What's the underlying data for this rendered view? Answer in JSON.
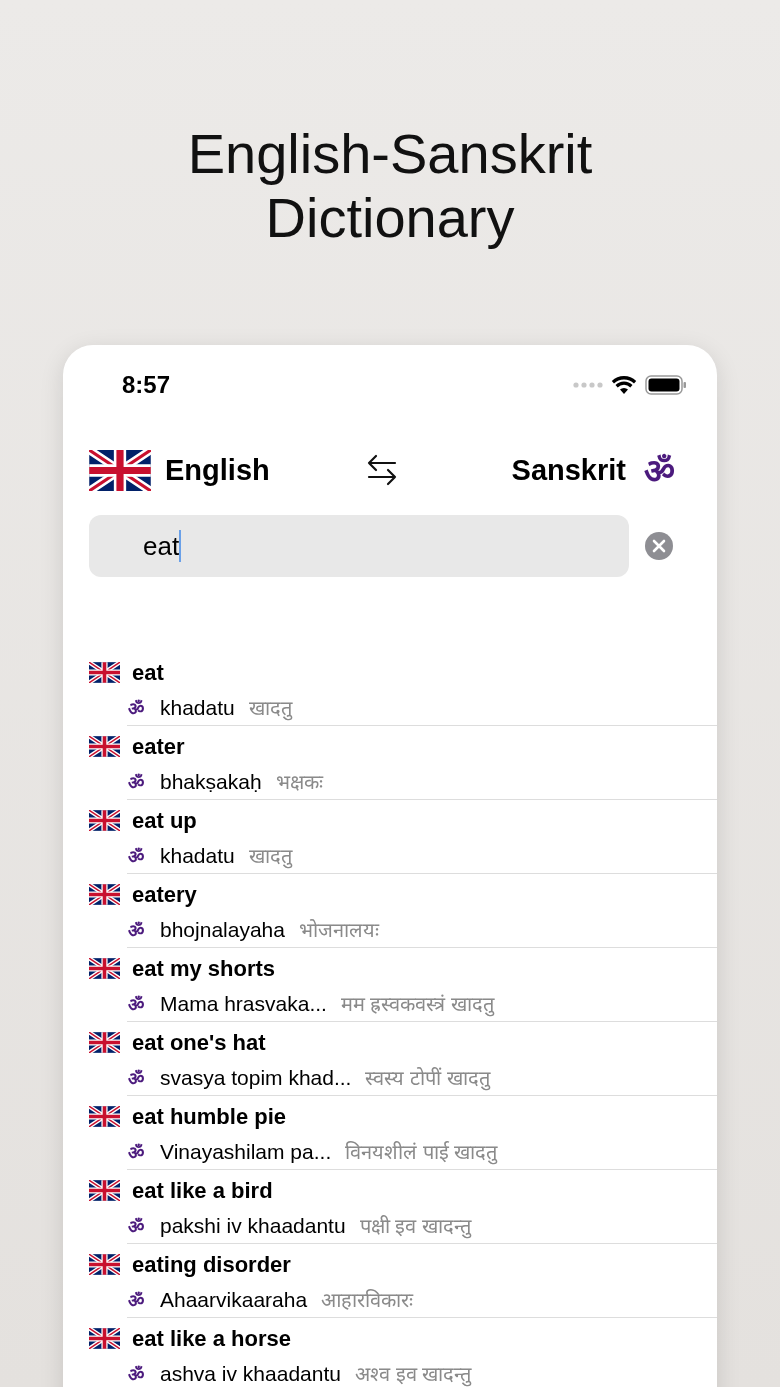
{
  "headline": [
    "English-Sanskrit",
    "Dictionary"
  ],
  "status_bar": {
    "time": "8:57"
  },
  "languages": {
    "source": "English",
    "target": "Sanskrit",
    "target_symbol": "ॐ"
  },
  "search": {
    "value": "eat"
  },
  "results": [
    {
      "word": "eat",
      "symbol": "ॐ",
      "translit": "khadatu",
      "devanagari": "खादतु"
    },
    {
      "word": "eater",
      "symbol": "ॐ",
      "translit": "bhakṣakaḥ",
      "devanagari": "भक्षकः"
    },
    {
      "word": "eat up",
      "symbol": "ॐ",
      "translit": "khadatu",
      "devanagari": "खादतु"
    },
    {
      "word": "eatery",
      "symbol": "ॐ",
      "translit": "bhojnalayaha",
      "devanagari": "भोजनालयः"
    },
    {
      "word": "eat my shorts",
      "symbol": "ॐ",
      "translit": "Mama hrasvaka...",
      "devanagari": "मम ह्रस्वकवस्त्रं खादतु"
    },
    {
      "word": "eat one's hat",
      "symbol": "ॐ",
      "translit": "svasya topim khad...",
      "devanagari": "स्वस्य टोपीं खादतु"
    },
    {
      "word": "eat humble pie",
      "symbol": "ॐ",
      "translit": "Vinayashilam pa...",
      "devanagari": "विनयशीलं पाई खादतु"
    },
    {
      "word": "eat like a bird",
      "symbol": "ॐ",
      "translit": "pakshi iv khaadantu",
      "devanagari": "पक्षी इव खादन्तु"
    },
    {
      "word": "eating disorder",
      "symbol": "ॐ",
      "translit": "Ahaarvikaaraha",
      "devanagari": "आहारविकारः"
    },
    {
      "word": "eat like a horse",
      "symbol": "ॐ",
      "translit": "ashva iv khaadantu",
      "devanagari": "अश्व इव खादन्तु"
    }
  ]
}
